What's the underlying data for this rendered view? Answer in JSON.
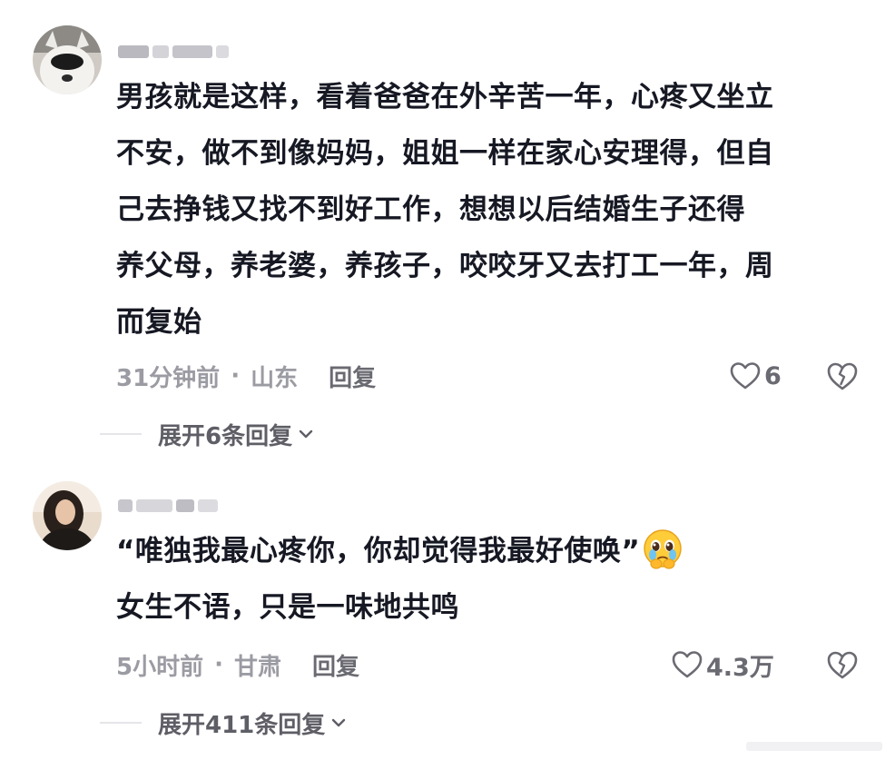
{
  "comments": [
    {
      "content_lines": [
        "男孩就是这样，看着爸爸在外辛苦一年，心疼又坐立",
        "不安，做不到像妈妈，姐姐一样在家心安理得，但自",
        "己去挣钱又找不到好工作，想想以后结婚生子还得",
        "养父母，养老婆，养孩子，咬咬牙又去打工一年，周",
        "而复始"
      ],
      "time": "31分钟前",
      "dot": "·",
      "location": "山东",
      "reply_label": "回复",
      "like_count": "6",
      "expand_label": "展开6条回复"
    },
    {
      "content_lines": [
        "“唯独我最心疼你，你却觉得我最好使唤”",
        "女生不语，只是一味地共鸣"
      ],
      "time": "5小时前",
      "dot": "·",
      "location": "甘肃",
      "reply_label": "回复",
      "like_count": "4.3万",
      "expand_label": "展开411条回复"
    }
  ],
  "icons": {
    "like": "heart-outline-icon",
    "dislike": "broken-heart-icon",
    "expand": "chevron-down-icon",
    "emoji": "pleading-face-emoji"
  },
  "colors": {
    "text_primary": "#161823",
    "text_secondary": "#9b9ba3",
    "text_action": "#6a6a72",
    "divider": "#e6e6ea"
  }
}
